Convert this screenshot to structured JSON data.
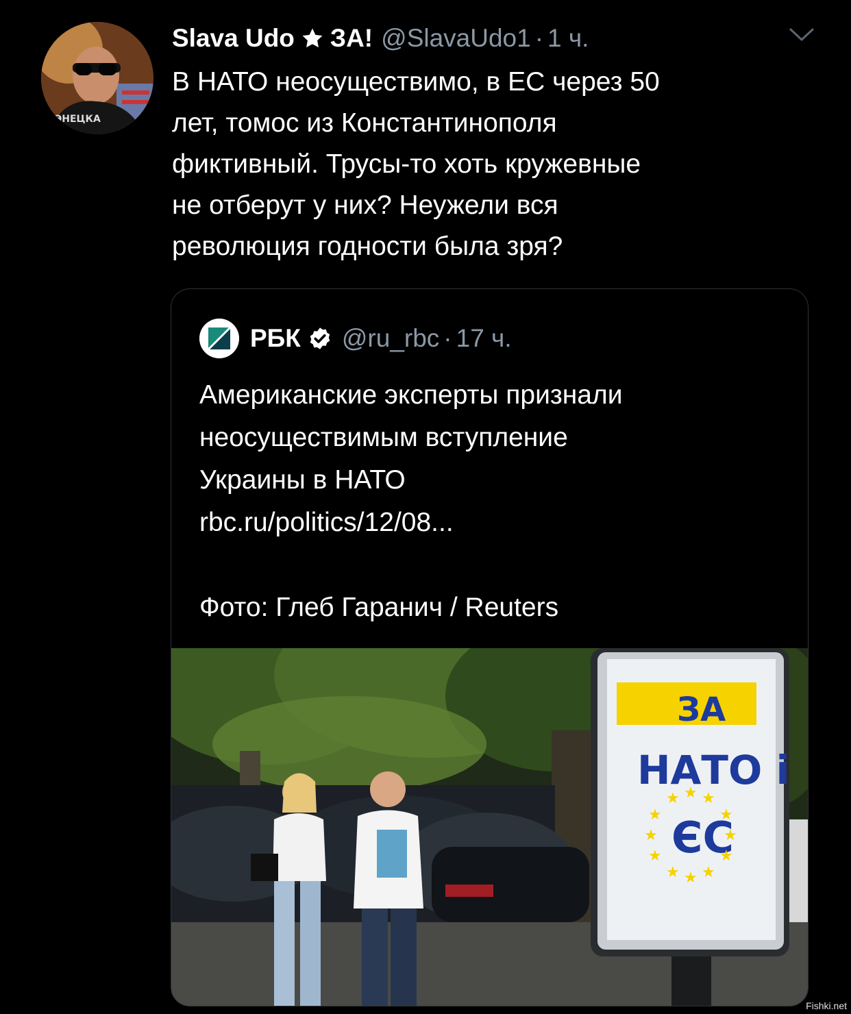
{
  "tweet": {
    "display_name": "Slava Udo",
    "name_suffix": "ЗА!",
    "handle": "@SlavaUdo1",
    "separator": "·",
    "time": "1 ч.",
    "text_lines": [
      "В НАТО неосуществимо, в ЕС через 50",
      "лет, томос из Константинополя",
      "фиктивный. Трусы-то хоть кружевные",
      "не отберут у них? Неужели вся",
      "революция годности была зря?"
    ]
  },
  "quoted_tweet": {
    "display_name": "РБК",
    "handle": "@ru_rbc",
    "separator": "·",
    "time": "17 ч.",
    "text_lines": [
      "Американские эксперты признали",
      "неосуществимым вступление",
      "Украины в НАТО",
      "rbc.ru/politics/12/08..."
    ],
    "photo_credit": "Фото: Глеб Гаранич / Reuters",
    "photo": {
      "billboard_line1": "ЗА",
      "billboard_line2": "НАТО і",
      "billboard_line3": "ЄС"
    }
  },
  "watermark": "Fishki.net",
  "icons": {
    "star": "star-icon",
    "verified": "verified-badge-icon",
    "more": "chevron-down-icon"
  },
  "colors": {
    "background": "#000000",
    "text": "#ffffff",
    "secondary_text": "#8b98a5",
    "border": "#2f3336",
    "billboard_yellow": "#f5d200",
    "eu_blue": "#1e3a9c"
  }
}
